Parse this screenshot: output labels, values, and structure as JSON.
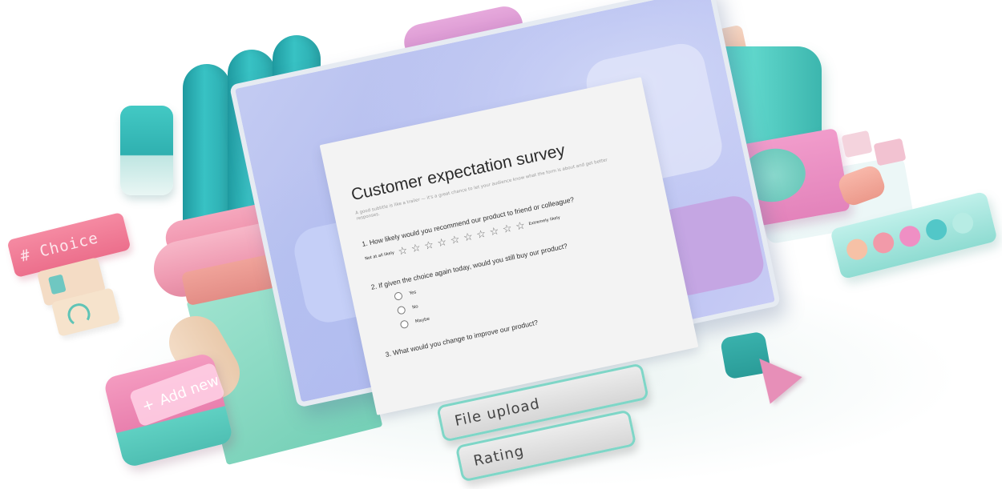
{
  "survey": {
    "title": "Customer expectation survey",
    "subtitle": "A good subtitle is like a trailer — it's a great chance to let your audience know what the form is about and get better responses.",
    "questions": [
      {
        "label": "1. How likely would you recommend our product to friend or colleague?",
        "type": "rating",
        "scale_min_label": "Not at all likely",
        "scale_max_label": "Extremely likely",
        "star_count": 10
      },
      {
        "label": "2. If given the choice again today, would you still buy our product?",
        "type": "choice",
        "options": [
          "Yes",
          "No",
          "Maybe"
        ]
      },
      {
        "label": "3. What would you change to improve our product?",
        "type": "text"
      }
    ]
  },
  "decor": {
    "choice_label": "# Choice",
    "add_new_label": "Add new",
    "add_new_symbol": "+",
    "file_upload_label": "File upload",
    "rating_label": "Rating"
  },
  "colors": {
    "teal": "#2fb0b0",
    "pink": "#ef8fa9",
    "lavender": "#aeb7ee",
    "mint": "#7ed6c7",
    "card": "#f3f3f3",
    "swatches": [
      "#f6c1a6",
      "#f29aa9",
      "#ef8fc4",
      "#52c7c8",
      "#b7ece4"
    ]
  },
  "icons": {
    "star": "☆",
    "radio": "radio-empty"
  }
}
